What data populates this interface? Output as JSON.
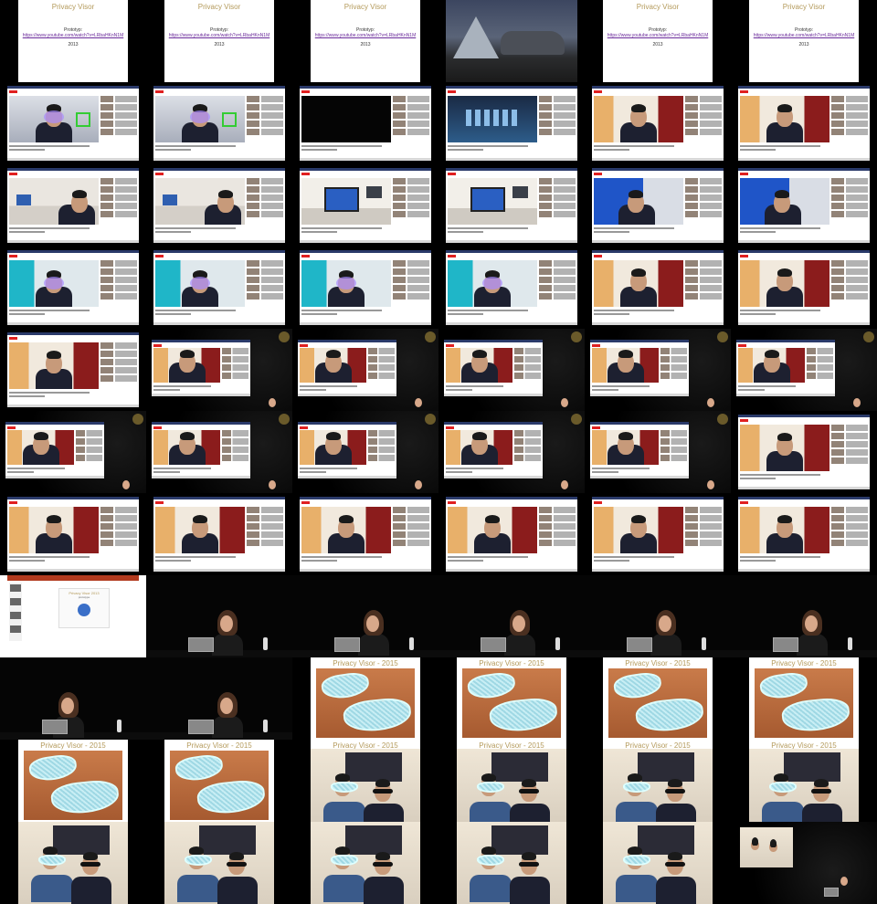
{
  "slide_texts": {
    "prototype_title": "Privacy Visor",
    "prototype_label": "Prototyp:",
    "prototype_url": "https://www.youtube.com/watch?v=LRbaHKnN1M",
    "prototype_year": "2013",
    "visor_title": "Privacy Visor - 2015",
    "ppt_heading": "Privacy Visor 2013",
    "ppt_sub": "prototype"
  },
  "colors": {
    "background": "#000000",
    "slide_title": "#b49a5b",
    "link": "#6a2a9a",
    "youtube_red": "#e02020"
  },
  "grid": {
    "columns": 6,
    "rows": 11,
    "frames": [
      "slide",
      "slide",
      "slide",
      "tent",
      "slide",
      "slide",
      "yt-visor",
      "yt-visor",
      "yt-black",
      "yt-logo",
      "yt-man",
      "yt-man",
      "yt-booth",
      "yt-booth",
      "yt-monitor",
      "yt-monitor",
      "yt-blue",
      "yt-blue",
      "yt-cyan",
      "yt-cyan",
      "yt-cyan",
      "yt-cyan",
      "yt-man",
      "yt-man",
      "yt-man",
      "pip",
      "pip",
      "pip",
      "pip",
      "pip",
      "pip",
      "pip",
      "pip",
      "pip",
      "pip",
      "yt-man",
      "yt-man",
      "yt-man",
      "yt-man",
      "yt-man",
      "yt-man",
      "yt-man",
      "ppt",
      "stage",
      "stage",
      "stage",
      "stage",
      "stage",
      "stage-look",
      "stage",
      "vslide-glasses",
      "vslide-glasses",
      "vslide-glasses",
      "vslide-glasses",
      "vslide-glasses",
      "vslide-glasses",
      "vslide-wearers",
      "vslide-wearers",
      "vslide-wearers",
      "vslide-wearers",
      "vslide-wearers-top",
      "vslide-wearers-top",
      "vslide-wearers-top",
      "vslide-wearers-top",
      "vslide-wearers-top",
      "pip-stage"
    ]
  }
}
